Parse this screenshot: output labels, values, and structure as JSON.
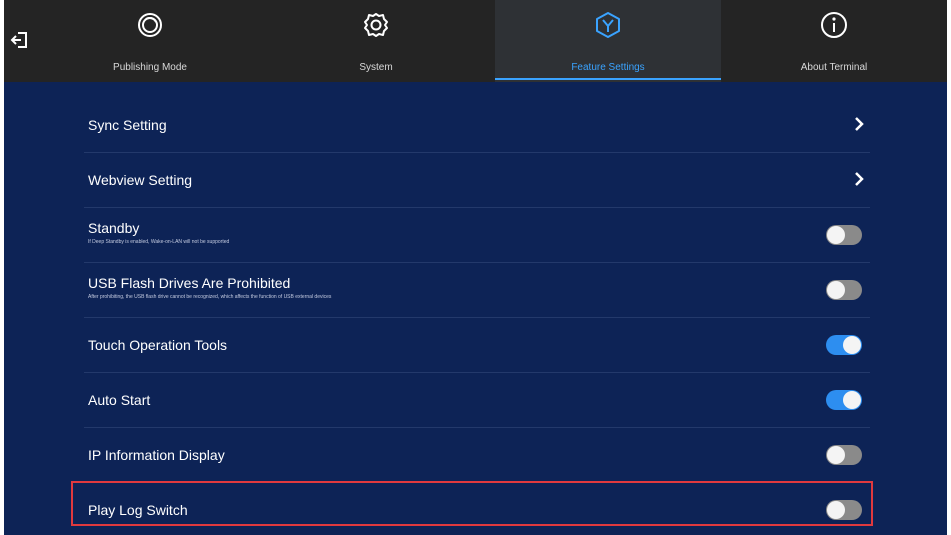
{
  "tabs": [
    {
      "label": "Publishing Mode",
      "icon": "publishing-mode-icon",
      "active": false
    },
    {
      "label": "System",
      "icon": "gear-icon",
      "active": false
    },
    {
      "label": "Feature Settings",
      "icon": "feature-settings-icon",
      "active": true
    },
    {
      "label": "About Terminal",
      "icon": "info-icon",
      "active": false
    }
  ],
  "colors": {
    "background": "#0d2356",
    "topbar": "#242424",
    "accent": "#3aa3ff",
    "toggle_on": "#2d8ef0",
    "toggle_off": "#8a8a8a",
    "highlight": "#e0393e"
  },
  "settings": [
    {
      "title": "Sync Setting",
      "type": "link"
    },
    {
      "title": "Webview Setting",
      "type": "link"
    },
    {
      "title": "Standby",
      "subtitle": "If Deep Standby is enabled, Wake-on-LAN will not be supported",
      "type": "toggle",
      "on": false
    },
    {
      "title": "USB Flash Drives Are Prohibited",
      "subtitle": "After prohibiting, the USB flash drive cannot be recognized, which affects the function of USB external devices",
      "type": "toggle",
      "on": false
    },
    {
      "title": "Touch Operation Tools",
      "type": "toggle",
      "on": true
    },
    {
      "title": "Auto Start",
      "type": "toggle",
      "on": true
    },
    {
      "title": "IP Information Display",
      "type": "toggle",
      "on": false
    },
    {
      "title": "Play Log Switch",
      "type": "toggle",
      "on": false,
      "highlighted": true
    }
  ]
}
